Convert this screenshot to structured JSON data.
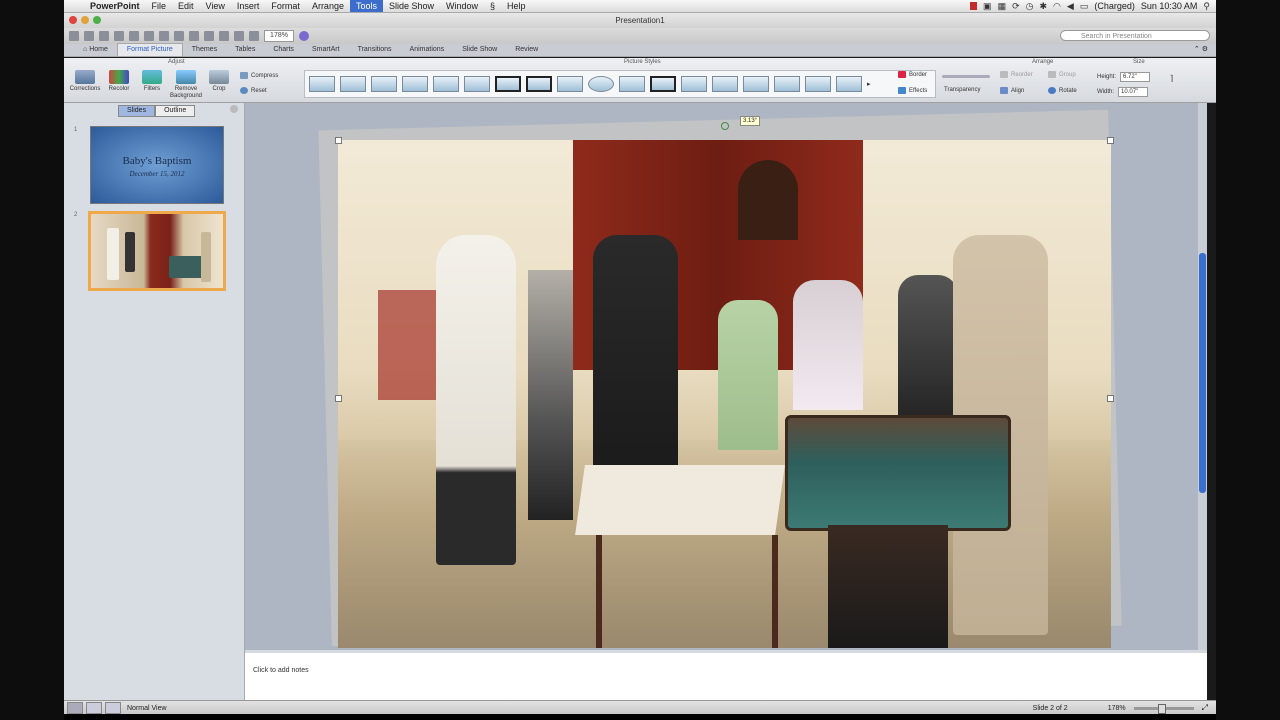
{
  "menubar": {
    "app": "PowerPoint",
    "items": [
      "File",
      "Edit",
      "View",
      "Insert",
      "Format",
      "Arrange",
      "Tools",
      "Slide Show",
      "Window",
      "Help"
    ],
    "active": "Tools",
    "battery": "(Charged)",
    "clock": "Sun 10:30 AM"
  },
  "window": {
    "title": "Presentation1"
  },
  "toolbar": {
    "zoom": "178%",
    "search_placeholder": "Search in Presentation"
  },
  "ribbon_tabs": [
    "Home",
    "Format Picture",
    "Themes",
    "Tables",
    "Charts",
    "SmartArt",
    "Transitions",
    "Animations",
    "Slide Show",
    "Review"
  ],
  "ribbon": {
    "groups": {
      "adjust": "Adjust",
      "picture_styles": "Picture Styles",
      "arrange": "Arrange",
      "size": "Size"
    },
    "adjust_buttons": [
      "Corrections",
      "Recolor",
      "Filters",
      "Remove Background",
      "Crop"
    ],
    "compress": "Compress",
    "reset": "Reset",
    "border": "Border",
    "effects": "Effects",
    "transparency": "Transparency",
    "reorder": "Reorder",
    "group": "Group",
    "align": "Align",
    "rotate": "Rotate",
    "height_label": "Height:",
    "height_value": "6.72\"",
    "width_label": "Width:",
    "width_value": "10.07\""
  },
  "left_pane": {
    "tabs": [
      "Slides",
      "Outline"
    ],
    "slide1": {
      "num": "1",
      "title": "Baby's Baptism",
      "date": "December 15, 2012"
    },
    "slide2": {
      "num": "2"
    }
  },
  "canvas": {
    "rotation_tooltip": "3.13°"
  },
  "notes": {
    "placeholder": "Click to add notes"
  },
  "status": {
    "view": "Normal View",
    "slide": "Slide 2 of 2",
    "zoom": "178%"
  }
}
